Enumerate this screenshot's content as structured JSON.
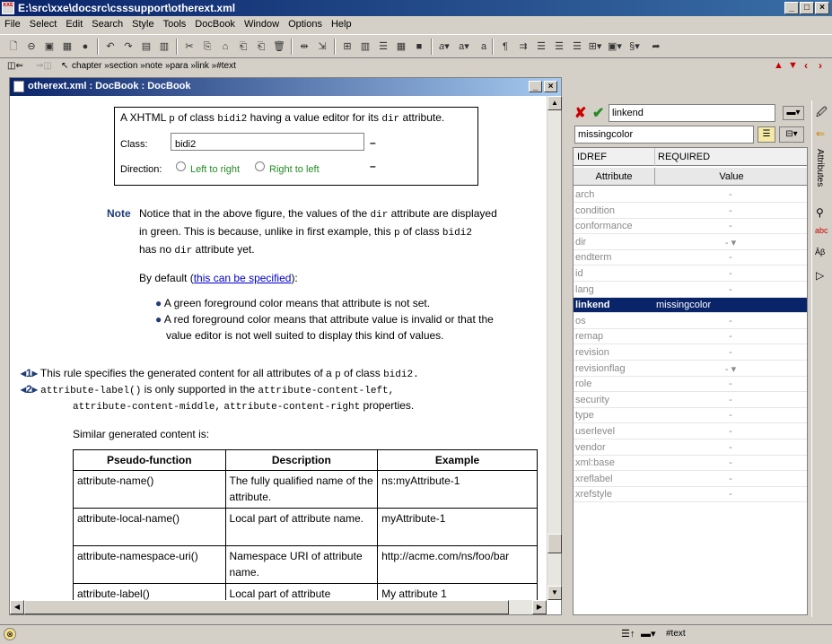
{
  "window": {
    "title": "E:\\src\\xxe\\docsrc\\csssupport\\otherext.xml",
    "app_icon": "XXE"
  },
  "menu": [
    "File",
    "Select",
    "Edit",
    "Search",
    "Style",
    "Tools",
    "DocBook",
    "Window",
    "Options",
    "Help"
  ],
  "breadcrumb": "chapter »section »note »para »link »#text",
  "doc": {
    "title": "otherext.xml : DocBook : DocBook",
    "demo_heading_a": "A XHTML",
    "demo_heading_p": "p",
    "demo_heading_b": "of class",
    "demo_heading_bidi": "bidi2",
    "demo_heading_c": "having a value editor for its",
    "demo_heading_dir": "dir",
    "demo_heading_d": "attribute.",
    "class_label": "Class:",
    "class_value": "bidi2",
    "direction_label": "Direction:",
    "ltr": "Left to right",
    "rtl": "Right to left",
    "note_label": "Note",
    "note_1": "Notice that in the above figure, the values of the",
    "note_dir": "dir",
    "note_2": "attribute are displayed",
    "note_3": "in green. This is because, unlike in first example, this",
    "note_p": "p",
    "note_4": "of class",
    "note_bidi": "bidi2",
    "note_5": "has no",
    "note_dir2": "dir",
    "note_6": "attribute yet.",
    "default_1": "By default (",
    "default_link": "this can be specified",
    "default_2": "):",
    "bullet_1": "A green foreground color means that attribute is not set.",
    "bullet_2a": "A red foreground color means that attribute value is invalid or that the",
    "bullet_2b": "value editor is not well suited to display this kind of values.",
    "callout_1_num": "1",
    "callout_1a": "This rule specifies the generated content for all attributes of a",
    "callout_1_p": "p",
    "callout_1b": "of class",
    "callout_1_bidi": "bidi2.",
    "callout_2_num": "2",
    "callout_2_code": "attribute-label()",
    "callout_2a": "is only supported in the",
    "callout_2_left": "attribute-content-left,",
    "callout_2_mid": "attribute-content-middle,",
    "callout_2_right": "attribute-content-right",
    "callout_2b": "properties.",
    "similar": "Similar generated content is:",
    "table_headers": [
      "Pseudo-function",
      "Description",
      "Example"
    ],
    "table_rows": [
      [
        "attribute-name()",
        "The fully qualified name of the attribute.",
        "ns:myAttribute-1"
      ],
      [
        "attribute-local-name()",
        "Local part of attribute name.",
        "myAttribute-1"
      ],
      [
        "attribute-namespace-uri()",
        "Namespace URI of attribute name.",
        "http://acme.com/ns/foo/bar"
      ],
      [
        "attribute-label()",
        "Local part of attribute",
        "My attribute 1"
      ]
    ]
  },
  "attrs": {
    "edit_name": "linkend",
    "edit_value": "missingcolor",
    "type": "IDREF",
    "required": "REQUIRED",
    "col_attr": "Attribute",
    "col_value": "Value",
    "side_tab": "Attributes",
    "rows": [
      {
        "name": "arch",
        "value": "-"
      },
      {
        "name": "condition",
        "value": "-"
      },
      {
        "name": "conformance",
        "value": "-"
      },
      {
        "name": "dir",
        "value": "- ▾"
      },
      {
        "name": "endterm",
        "value": "-"
      },
      {
        "name": "id",
        "value": "-"
      },
      {
        "name": "lang",
        "value": "-"
      },
      {
        "name": "linkend",
        "value": "missingcolor"
      },
      {
        "name": "os",
        "value": "-"
      },
      {
        "name": "remap",
        "value": "-"
      },
      {
        "name": "revision",
        "value": "-"
      },
      {
        "name": "revisionflag",
        "value": "- ▾"
      },
      {
        "name": "role",
        "value": "-"
      },
      {
        "name": "security",
        "value": "-"
      },
      {
        "name": "type",
        "value": "-"
      },
      {
        "name": "userlevel",
        "value": "-"
      },
      {
        "name": "vendor",
        "value": "-"
      },
      {
        "name": "xml:base",
        "value": "-"
      },
      {
        "name": "xreflabel",
        "value": "-"
      },
      {
        "name": "xrefstyle",
        "value": "-"
      }
    ]
  },
  "status": {
    "node": "#text"
  },
  "colors": {
    "titlebar": "#0a246a",
    "green": "#228b22",
    "selection": "#0a246a"
  }
}
